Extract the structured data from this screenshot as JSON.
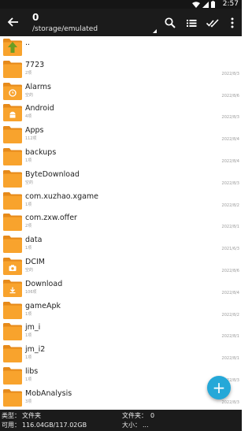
{
  "status_bar": {
    "time": "2:57"
  },
  "app_bar": {
    "title": "0",
    "path": "/storage/emulated"
  },
  "files": [
    {
      "name": "..",
      "meta": "",
      "date": "",
      "icon": "up-arrow-icon"
    },
    {
      "name": "7723",
      "meta": "2项",
      "date": "2022/8/3",
      "icon": ""
    },
    {
      "name": "Alarms",
      "meta": "空的",
      "date": "2022/8/6",
      "icon": "alarm-icon"
    },
    {
      "name": "Android",
      "meta": "4项",
      "date": "2022/8/3",
      "icon": "android-icon"
    },
    {
      "name": "Apps",
      "meta": "112项",
      "date": "2022/8/4",
      "icon": ""
    },
    {
      "name": "backups",
      "meta": "1项",
      "date": "2022/8/4",
      "icon": ""
    },
    {
      "name": "ByteDownload",
      "meta": "空的",
      "date": "2022/8/3",
      "icon": ""
    },
    {
      "name": "com.xuzhao.xgame",
      "meta": "1项",
      "date": "2022/8/2",
      "icon": ""
    },
    {
      "name": "com.zxw.offer",
      "meta": "2项",
      "date": "2022/8/1",
      "icon": ""
    },
    {
      "name": "data",
      "meta": "1项",
      "date": "2021/6/3",
      "icon": ""
    },
    {
      "name": "DCIM",
      "meta": "空的",
      "date": "2022/8/6",
      "icon": "camera-icon"
    },
    {
      "name": "Download",
      "meta": "106项",
      "date": "2022/8/4",
      "icon": "download-icon"
    },
    {
      "name": "gameApk",
      "meta": "1项",
      "date": "2022/8/2",
      "icon": ""
    },
    {
      "name": "jm_i",
      "meta": "1项",
      "date": "2022/8/1",
      "icon": ""
    },
    {
      "name": "jm_i2",
      "meta": "1项",
      "date": "2022/8/1",
      "icon": ""
    },
    {
      "name": "libs",
      "meta": "1项",
      "date": "2022/8/3",
      "icon": ""
    },
    {
      "name": "MobAnalysis",
      "meta": "3项",
      "date": "2022/8/3",
      "icon": ""
    },
    {
      "name": "",
      "meta": "",
      "date": "",
      "icon": ""
    }
  ],
  "footer": {
    "type_label": "类型：",
    "type_value": "文件夹",
    "avail_label": "可用：",
    "avail_value": "116.04GB/117.02GB",
    "folders_label": "文件夹：",
    "folders_value": "0",
    "size_label": "大小：",
    "size_value": "..."
  },
  "colors": {
    "folder": "#f8a32d",
    "folder_tab": "#e68a1a",
    "appbar": "#1b1b1b",
    "fab": "#25a8d8"
  }
}
